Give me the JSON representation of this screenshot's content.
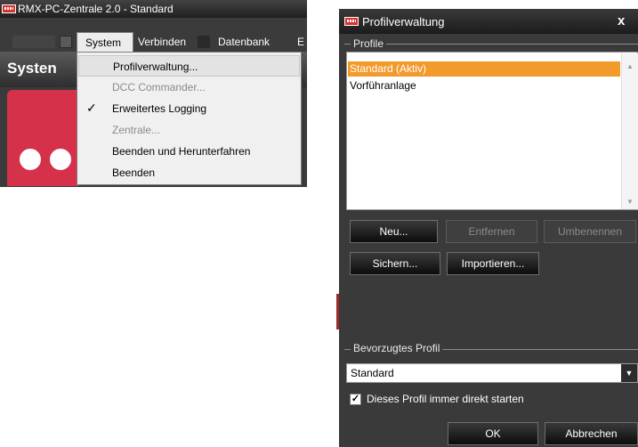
{
  "main_window": {
    "title": "RMX-PC-Zentrale 2.0 - Standard",
    "menubar": {
      "items": [
        "System",
        "Verbinden",
        "Datenbank",
        "E"
      ]
    },
    "section_header": "Systen",
    "dropdown": {
      "items": [
        {
          "label": "Profilverwaltung...",
          "enabled": true,
          "highlighted": true,
          "checked": false
        },
        {
          "label": "DCC Commander...",
          "enabled": false,
          "checked": false
        },
        {
          "label": "Erweitertes Logging",
          "enabled": true,
          "checked": true
        },
        {
          "label": "Zentrale...",
          "enabled": false,
          "checked": false
        },
        {
          "label": "Beenden und Herunterfahren",
          "enabled": true,
          "checked": false
        },
        {
          "label": "Beenden",
          "enabled": true,
          "checked": false
        }
      ]
    }
  },
  "dialog": {
    "title": "Profilverwaltung",
    "close_icon": "x",
    "profiles_group_label": "Profile",
    "profiles": [
      {
        "name": "Standard (Aktiv)",
        "selected": true
      },
      {
        "name": "Vorführanlage",
        "selected": false
      }
    ],
    "buttons": {
      "new": "Neu...",
      "remove": "Entfernen",
      "rename": "Umbenennen",
      "save": "Sichern...",
      "import": "Importieren..."
    },
    "preferred_group_label": "Bevorzugtes Profil",
    "preferred_profile": "Standard",
    "start_directly_label": "Dieses Profil immer direkt starten",
    "start_directly_checked": true,
    "ok": "OK",
    "cancel": "Abbrechen"
  },
  "colors": {
    "selection": "#f39a2c",
    "app_red": "#d6314a",
    "window_bg": "#3a3a3a"
  }
}
